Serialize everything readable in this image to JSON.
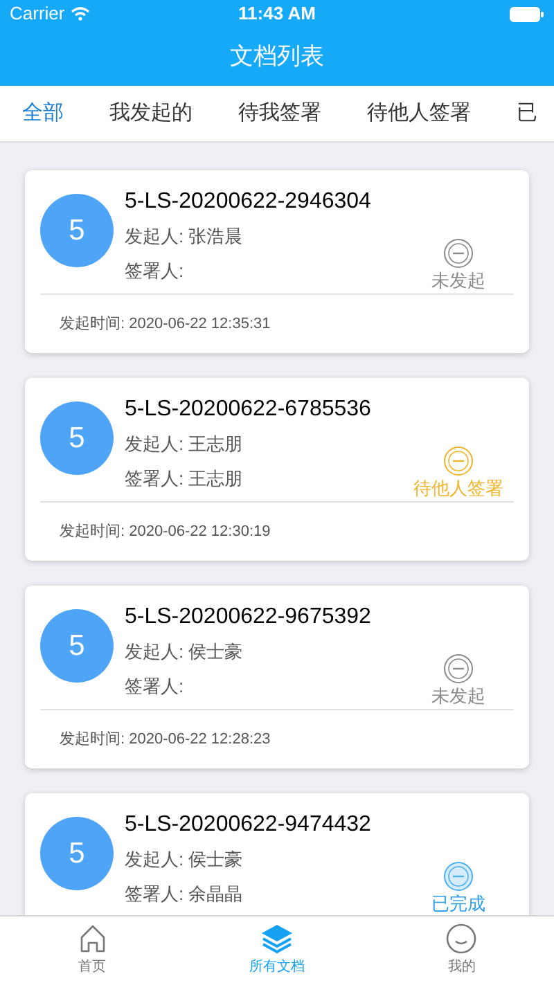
{
  "status_bar": {
    "carrier": "Carrier",
    "time": "11:43 AM"
  },
  "nav": {
    "title": "文档列表"
  },
  "tabs": [
    {
      "label": "全部",
      "selected": true
    },
    {
      "label": "我发起的",
      "selected": false
    },
    {
      "label": "待我签署",
      "selected": false
    },
    {
      "label": "待他人签署",
      "selected": false
    },
    {
      "label": "已",
      "selected": false
    }
  ],
  "documents": [
    {
      "badge": "5",
      "title": "5-LS-20200622-2946304",
      "initiator": "发起人: 张浩晨",
      "signer": "签署人:",
      "status": "未发起",
      "kind": "not_started",
      "time": "发起时间: 2020-06-22 12:35:31"
    },
    {
      "badge": "5",
      "title": "5-LS-20200622-6785536",
      "initiator": "发起人: 王志朋",
      "signer": "签署人: 王志朋",
      "status": "待他人签署",
      "kind": "pending",
      "time": "发起时间: 2020-06-22 12:30:19"
    },
    {
      "badge": "5",
      "title": "5-LS-20200622-9675392",
      "initiator": "发起人: 侯士豪",
      "signer": "签署人:",
      "status": "未发起",
      "kind": "not_started",
      "time": "发起时间: 2020-06-22 12:28:23"
    },
    {
      "badge": "5",
      "title": "5-LS-20200622-9474432",
      "initiator": "发起人: 侯士豪",
      "signer": "签署人: 余晶晶",
      "status": "已完成",
      "kind": "completed"
    }
  ],
  "tab_bar": [
    {
      "label": "首页",
      "kind": "home",
      "selected": false
    },
    {
      "label": "所有文档",
      "kind": "layers",
      "selected": true
    },
    {
      "label": "我的",
      "kind": "smile",
      "selected": false
    }
  ]
}
